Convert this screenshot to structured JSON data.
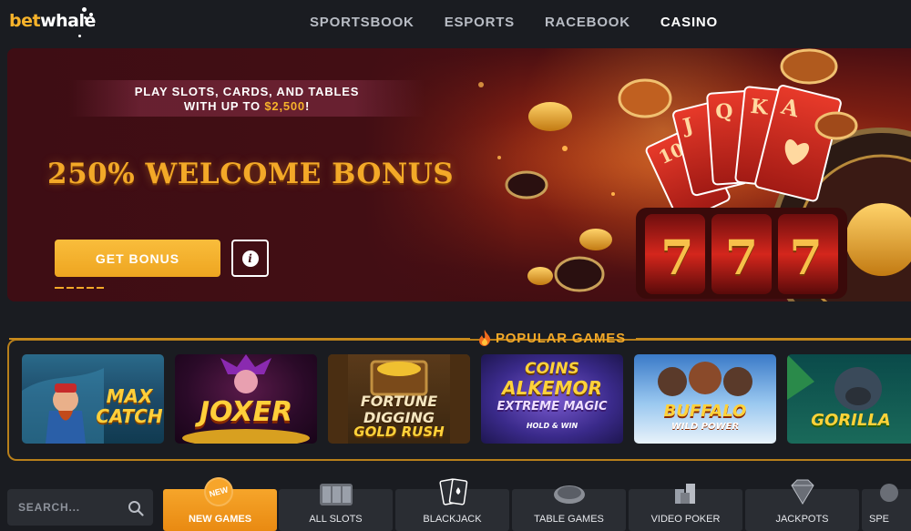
{
  "header": {
    "logo_bet": "bet",
    "logo_whale": "whale",
    "nav": [
      {
        "label": "SPORTSBOOK",
        "active": false
      },
      {
        "label": "ESPORTS",
        "active": false
      },
      {
        "label": "RACEBOOK",
        "active": false
      },
      {
        "label": "CASINO",
        "active": true
      }
    ]
  },
  "banner": {
    "promo_line1": "PLAY SLOTS, CARDS, AND TABLES",
    "promo_line2_prefix": "WITH UP TO ",
    "promo_amount": "$2,500",
    "promo_line2_suffix": "!",
    "title": "250% WELCOME BONUS",
    "cta_label": "GET BONUS",
    "info_glyph": "i",
    "slot_reels": [
      "7",
      "7",
      "7"
    ]
  },
  "popular": {
    "title": "POPULAR GAMES",
    "games": [
      {
        "name": "MAX CATCH",
        "line1": "MAX",
        "line2": "CATCH"
      },
      {
        "name": "JOXER",
        "line1": "JOXER",
        "line2": ""
      },
      {
        "name": "FORTUNE DIGGING GOLD RUSH",
        "line1": "FORTUNE",
        "line2": "DIGGING",
        "line3": "GOLD RUSH"
      },
      {
        "name": "COINS OF ALKEMOR EXTREME MAGIC HOLD & WIN",
        "line1": "COINS",
        "line2": "ALKEMOR",
        "line3": "EXTREME MAGIC",
        "line4": "HOLD & WIN"
      },
      {
        "name": "BUFFALO WILD POWER",
        "line1": "BUFFALO",
        "line2": "WILD POWER"
      },
      {
        "name": "GORILLA",
        "line1": "GORILLA",
        "line2": ""
      }
    ]
  },
  "categories": {
    "search_placeholder": "SEARCH...",
    "new_badge": "NEW",
    "items": [
      {
        "label": "NEW GAMES",
        "icon": "new-badge",
        "active": true
      },
      {
        "label": "ALL SLOTS",
        "icon": "slot-reels-icon",
        "active": false
      },
      {
        "label": "BLACKJACK",
        "icon": "playing-cards-icon",
        "active": false
      },
      {
        "label": "TABLE GAMES",
        "icon": "roulette-table-icon",
        "active": false
      },
      {
        "label": "VIDEO POKER",
        "icon": "chip-stack-icon",
        "active": false
      },
      {
        "label": "JACKPOTS",
        "icon": "diamond-icon",
        "active": false
      },
      {
        "label": "SPE",
        "icon": "specials-icon",
        "active": false
      }
    ]
  },
  "colors": {
    "accent": "#f3a928",
    "background": "#1a1c21",
    "tile": "#2a2d33",
    "banner_dark": "#3e0d14"
  }
}
